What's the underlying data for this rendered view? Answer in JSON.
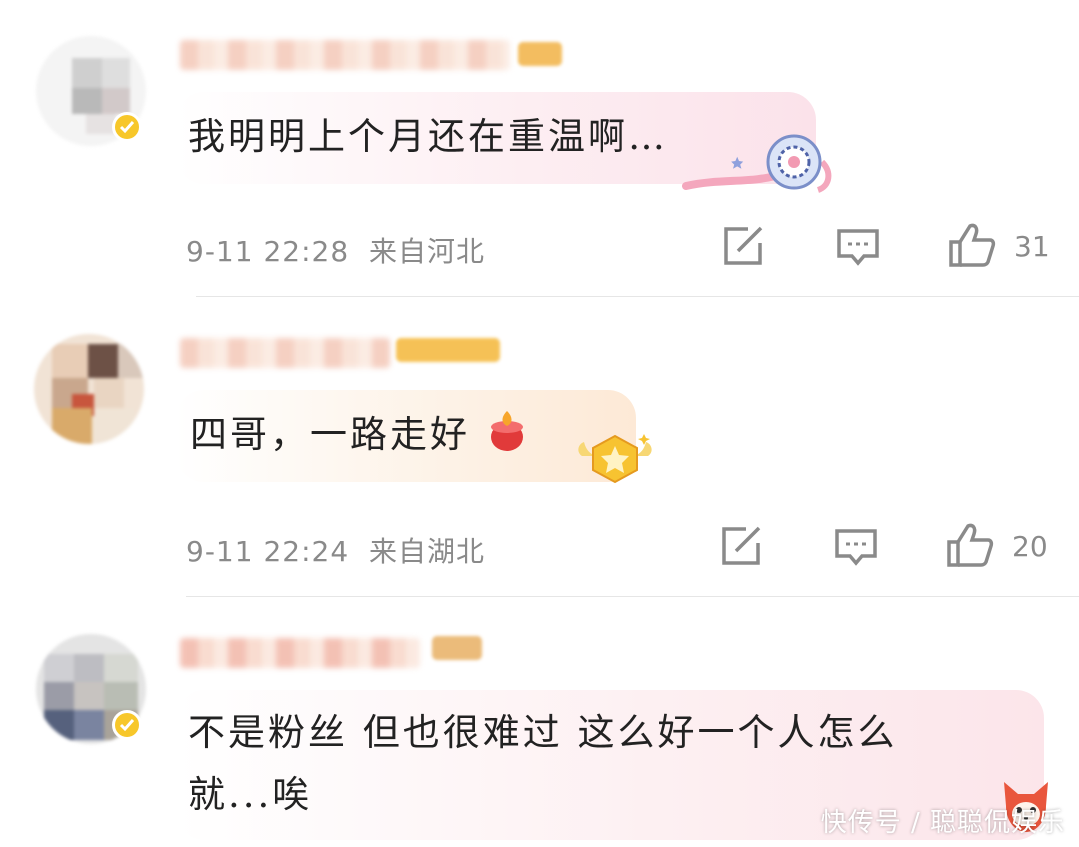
{
  "comments": [
    {
      "text": "我明明上个月还在重温啊…",
      "time": "9-11 22:28",
      "location": "来自河北",
      "likes": "31",
      "verified": true
    },
    {
      "text": "四哥，一路走好",
      "emoji": "candle-emoji",
      "time": "9-11 22:24",
      "location": "来自湖北",
      "likes": "20",
      "verified": false
    },
    {
      "text_line1": "不是粉丝 但也很难过 这么好一个人怎么",
      "text_line2": "就...唉",
      "verified": true
    }
  ],
  "icons": {
    "share": "share-icon",
    "reply": "comment-icon",
    "like": "thumbs-up-icon"
  },
  "watermark": "快传号 / 聪聪侃娱乐",
  "colors": {
    "meta_gray": "#8a8a8a",
    "bubble_pink": "#fce9ee",
    "bubble_peach": "#fdf0e4",
    "verified_gold": "#f7c72a"
  }
}
